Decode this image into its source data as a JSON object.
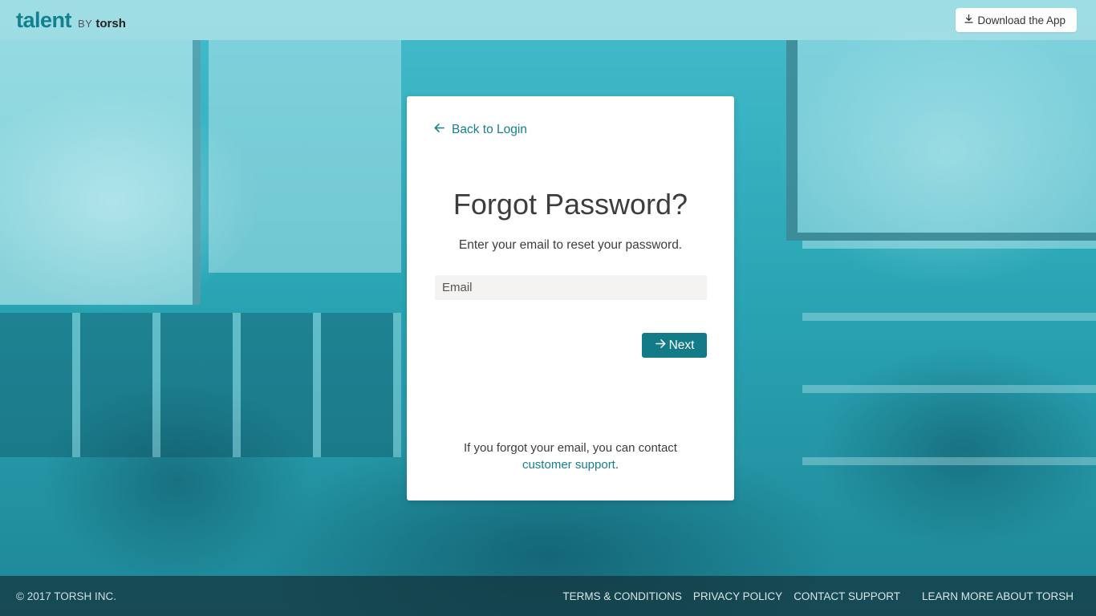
{
  "header": {
    "brand_name": "talent",
    "brand_by": "BY",
    "brand_company": "torsh",
    "download_label": "Download the App"
  },
  "card": {
    "back_label": "Back to Login",
    "title": "Forgot Password?",
    "subtitle": "Enter your email to reset your password.",
    "email_placeholder": "Email",
    "email_value": "",
    "next_label": "Next",
    "help_text": "If you forgot your email, you can contact",
    "help_link": "customer support",
    "help_suffix": "."
  },
  "footer": {
    "copyright": "© 2017 TORSH INC.",
    "links": [
      "TERMS & CONDITIONS",
      "PRIVACY POLICY",
      "CONTACT SUPPORT",
      "LEARN MORE ABOUT TORSH"
    ]
  },
  "colors": {
    "accent": "#137a88",
    "link": "#167f8e",
    "background_tint": "#2aa3b3"
  },
  "icons": {
    "download": "download-icon",
    "back": "arrow-left-icon",
    "next": "arrow-right-icon"
  }
}
